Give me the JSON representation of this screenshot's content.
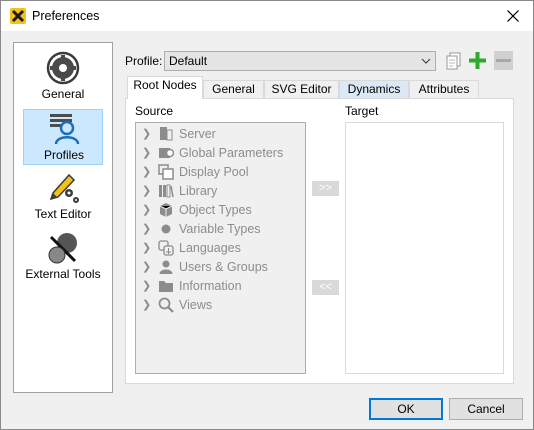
{
  "window": {
    "title": "Preferences"
  },
  "sidebar": {
    "items": [
      {
        "label": "General",
        "icon": "gear-icon",
        "selected": false
      },
      {
        "label": "Profiles",
        "icon": "profiles-icon",
        "selected": true
      },
      {
        "label": "Text Editor",
        "icon": "pencil-gears-icon",
        "selected": false
      },
      {
        "label": "External Tools",
        "icon": "external-tools-icon",
        "selected": false
      }
    ]
  },
  "profile": {
    "label": "Profile:",
    "value": "Default"
  },
  "tabs": [
    {
      "label": "Root Nodes",
      "active": true
    },
    {
      "label": "General",
      "active": false
    },
    {
      "label": "SVG Editor",
      "active": false
    },
    {
      "label": "Dynamics",
      "active": false
    },
    {
      "label": "Attributes",
      "active": false
    }
  ],
  "root_nodes": {
    "source_label": "Source",
    "target_label": "Target",
    "add_button": ">>",
    "remove_button": "<<",
    "source_items": [
      {
        "label": "Server",
        "icon": "server-icon"
      },
      {
        "label": "Global Parameters",
        "icon": "parameters-icon"
      },
      {
        "label": "Display Pool",
        "icon": "display-pool-icon"
      },
      {
        "label": "Library",
        "icon": "library-icon"
      },
      {
        "label": "Object Types",
        "icon": "cube-icon"
      },
      {
        "label": "Variable Types",
        "icon": "dot-icon"
      },
      {
        "label": "Languages",
        "icon": "languages-icon"
      },
      {
        "label": "Users & Groups",
        "icon": "user-icon"
      },
      {
        "label": "Information",
        "icon": "folder-icon"
      },
      {
        "label": "Views",
        "icon": "magnifier-icon"
      }
    ],
    "target_items": []
  },
  "footer": {
    "ok_label": "OK",
    "cancel_label": "Cancel"
  },
  "colors": {
    "accent": "#0078d7",
    "selected_bg": "#cce8ff",
    "add_green": "#2fa82f",
    "disabled_gray": "#8c8c8c"
  }
}
